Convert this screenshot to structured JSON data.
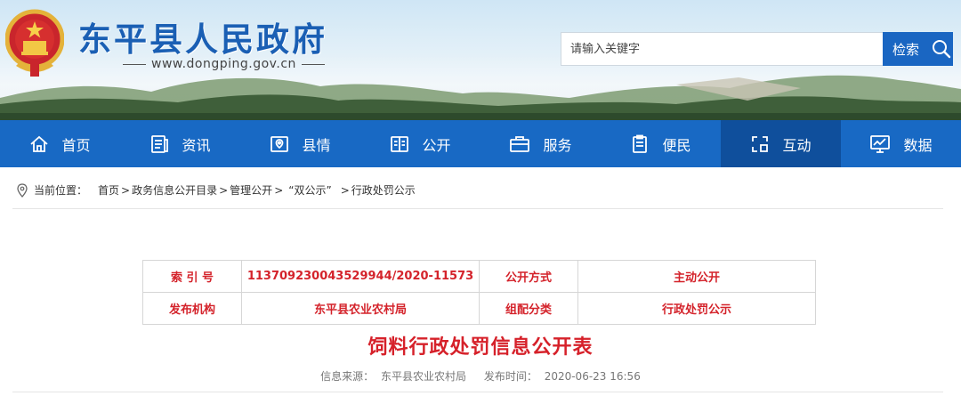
{
  "header": {
    "site_title": "东平县人民政府",
    "site_url": "www.dongping.gov.cn",
    "emblem_icon": "national-emblem-icon",
    "colors": {
      "title": "#1a5fb4",
      "nav": "#1869c4",
      "nav_active": "#0f4f9c",
      "accent_red": "#d4232b"
    }
  },
  "search": {
    "placeholder": "请输入关键字",
    "button_label": "检索",
    "icon": "search-icon"
  },
  "nav": {
    "items": [
      {
        "label": "首页",
        "icon": "home-icon"
      },
      {
        "label": "资讯",
        "icon": "news-icon"
      },
      {
        "label": "县情",
        "icon": "map-icon"
      },
      {
        "label": "公开",
        "icon": "book-icon"
      },
      {
        "label": "服务",
        "icon": "briefcase-icon"
      },
      {
        "label": "便民",
        "icon": "clipboard-icon"
      },
      {
        "label": "互动",
        "icon": "interact-icon",
        "active": true
      },
      {
        "label": "数据",
        "icon": "chart-monitor-icon"
      }
    ]
  },
  "breadcrumb": {
    "prefix": "当前位置：",
    "items": [
      "首页",
      "政务信息公开目录",
      "管理公开",
      "“双公示”",
      "行政处罚公示"
    ],
    "separator": ">"
  },
  "info_table": {
    "rows": [
      {
        "label1": "索 引 号",
        "value1": "113709230043529944/2020-11573",
        "label2": "公开方式",
        "value2": "主动公开"
      },
      {
        "label1": "发布机构",
        "value1": "东平县农业农村局",
        "label2": "组配分类",
        "value2": "行政处罚公示"
      }
    ]
  },
  "document": {
    "title": "饲料行政处罚信息公开表",
    "source_label": "信息来源：",
    "source": "东平县农业农村局",
    "time_label": "发布时间：",
    "time": "2020-06-23 16:56"
  }
}
